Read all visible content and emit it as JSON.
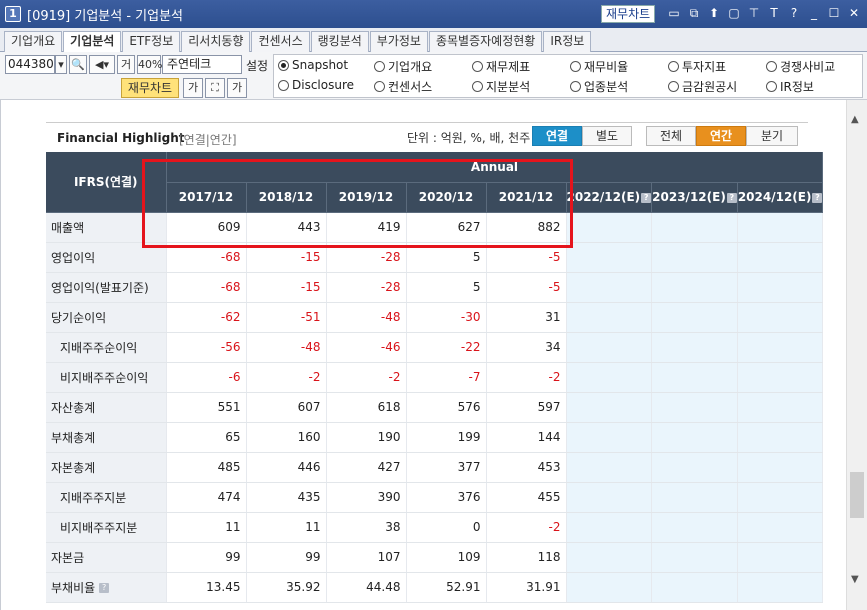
{
  "window": {
    "num": "1",
    "title": "[0919] 기업분석 - 기업분석",
    "top_button": "재무차트",
    "icons": [
      "chart-icon",
      "restore-icon",
      "pin-icon",
      "window-icon",
      "pushpin-icon",
      "font-icon",
      "help-icon",
      "minimize-icon",
      "maximize-icon",
      "close-icon"
    ],
    "icon_glyphs": [
      "▭",
      "⧉",
      "⬆",
      "▢",
      "⊤",
      "T",
      "?",
      "_",
      "☐",
      "✕"
    ]
  },
  "tabs": [
    "기업개요",
    "기업분석",
    "ETF정보",
    "리서치동향",
    "컨센서스",
    "랭킹분석",
    "부가정보",
    "종목별증자예정현황",
    "IR정보"
  ],
  "active_tab": "기업분석",
  "controls": {
    "code": "044380",
    "ga_label": "거",
    "percent": "40%",
    "name": "주연테크",
    "setting": "설정",
    "jaemu_chart": "재무차트",
    "ga_small": "가",
    "ga_up": "가"
  },
  "radios": [
    {
      "label": "Snapshot",
      "checked": true
    },
    {
      "label": "기업개요",
      "checked": false
    },
    {
      "label": "재무제표",
      "checked": false
    },
    {
      "label": "재무비율",
      "checked": false
    },
    {
      "label": "투자지표",
      "checked": false
    },
    {
      "label": "경쟁사비교",
      "checked": false
    },
    {
      "label": "Disclosure",
      "checked": false
    },
    {
      "label": "컨센서스",
      "checked": false
    },
    {
      "label": "지분분석",
      "checked": false
    },
    {
      "label": "업종분석",
      "checked": false
    },
    {
      "label": "금감원공시",
      "checked": false
    },
    {
      "label": "IR정보",
      "checked": false
    }
  ],
  "highlight": {
    "title": "Financial Highlight",
    "subtitle": "[연결|연간]",
    "unit": "단위 : 억원, %, 배, 천주",
    "btn_consolidated": "연결",
    "btn_separate": "별도",
    "btn_all": "전체",
    "btn_annual": "연간",
    "btn_quarter": "분기"
  },
  "table": {
    "corner": "IFRS(연결)",
    "group_header": "Annual",
    "columns": [
      "2017/12",
      "2018/12",
      "2019/12",
      "2020/12",
      "2021/12",
      "2022/12(E)",
      "2023/12(E)",
      "2024/12(E)"
    ],
    "rows": [
      {
        "label": "매출액",
        "indent": false,
        "values": [
          "609",
          "443",
          "419",
          "627",
          "882",
          "",
          "",
          ""
        ]
      },
      {
        "label": "영업이익",
        "indent": false,
        "values": [
          "-68",
          "-15",
          "-28",
          "5",
          "-5",
          "",
          "",
          ""
        ]
      },
      {
        "label": "영업이익(발표기준)",
        "indent": false,
        "values": [
          "-68",
          "-15",
          "-28",
          "5",
          "-5",
          "",
          "",
          ""
        ]
      },
      {
        "label": "당기순이익",
        "indent": false,
        "values": [
          "-62",
          "-51",
          "-48",
          "-30",
          "31",
          "",
          "",
          ""
        ]
      },
      {
        "label": "지배주주순이익",
        "indent": true,
        "values": [
          "-56",
          "-48",
          "-46",
          "-22",
          "34",
          "",
          "",
          ""
        ]
      },
      {
        "label": "비지배주주순이익",
        "indent": true,
        "values": [
          "-6",
          "-2",
          "-2",
          "-7",
          "-2",
          "",
          "",
          ""
        ]
      },
      {
        "label": "자산총계",
        "indent": false,
        "values": [
          "551",
          "607",
          "618",
          "576",
          "597",
          "",
          "",
          ""
        ]
      },
      {
        "label": "부채총계",
        "indent": false,
        "values": [
          "65",
          "160",
          "190",
          "199",
          "144",
          "",
          "",
          ""
        ]
      },
      {
        "label": "자본총계",
        "indent": false,
        "values": [
          "485",
          "446",
          "427",
          "377",
          "453",
          "",
          "",
          ""
        ]
      },
      {
        "label": "지배주주지분",
        "indent": true,
        "values": [
          "474",
          "435",
          "390",
          "376",
          "455",
          "",
          "",
          ""
        ]
      },
      {
        "label": "비지배주주지분",
        "indent": true,
        "values": [
          "11",
          "11",
          "38",
          "0",
          "-2",
          "",
          "",
          ""
        ]
      },
      {
        "label": "자본금",
        "indent": false,
        "values": [
          "99",
          "99",
          "107",
          "109",
          "118",
          "",
          "",
          ""
        ]
      },
      {
        "label": "부채비율",
        "indent": false,
        "values": [
          "13.45",
          "35.92",
          "44.48",
          "52.91",
          "31.91",
          "",
          "",
          ""
        ]
      }
    ]
  }
}
